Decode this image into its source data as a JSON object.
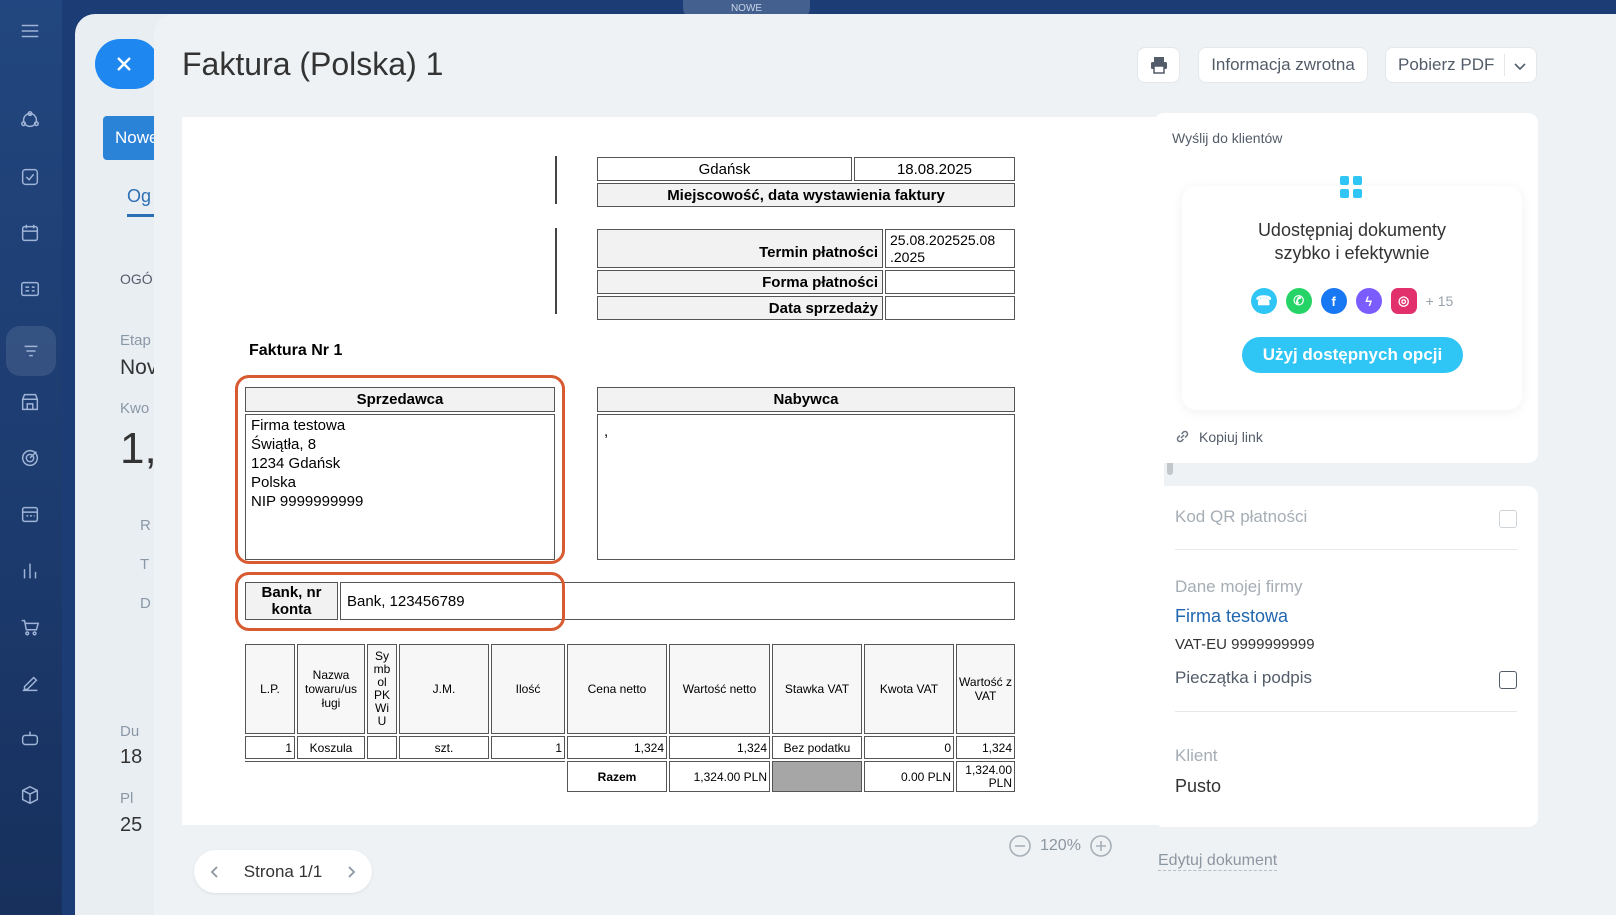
{
  "top_badge": "NOWE",
  "background": {
    "new_button": "Nowe",
    "tab": "Og",
    "section": "OGÓ",
    "stage_label": "Etap",
    "stage_value": "Nov",
    "amount_label": "Kwo",
    "amount_value": "1,",
    "r1": "R",
    "r2": "T",
    "r3": "D",
    "r4": "Du",
    "r5": "18",
    "r6": "Pl",
    "r7": "25"
  },
  "header": {
    "title": "Faktura (Polska) 1",
    "feedback": "Informacja zwrotna",
    "download": "Pobierz PDF"
  },
  "invoice": {
    "place": "Gdańsk",
    "issue_date": "18.08.2025",
    "place_date_label": "Miejscowość, data wystawienia faktury",
    "due_label": "Termin płatności",
    "due_value_1": "25.08.202525.08",
    "due_value_2": ".2025",
    "payment_form_label": "Forma płatności",
    "sale_date_label": "Data sprzedaży",
    "number": "Faktura Nr 1",
    "seller_label": "Sprzedawca",
    "seller_lines": [
      "Firma testowa",
      "Świątła, 8",
      "1234 Gdańsk",
      "Polska",
      "NIP 9999999999"
    ],
    "buyer_label": "Nabywca",
    "buyer_text": ",",
    "bank_label_1": "Bank, nr",
    "bank_label_2": "konta",
    "bank_value": "Bank, 123456789",
    "items_headers": {
      "lp": "L.P.",
      "name_1": "Nazwa",
      "name_2": "towaru/us",
      "name_3": "ługi",
      "sym": [
        "Sy",
        "mb",
        "ol",
        "PK",
        "Wi",
        "U"
      ],
      "unit": "J.M.",
      "qty": "Ilość",
      "price": "Cena netto",
      "net": "Wartość netto",
      "vat_rate": "Stawka VAT",
      "vat_amount": "Kwota VAT",
      "gross_1": "Wartość z",
      "gross_2": "VAT"
    },
    "items": [
      {
        "lp": "1",
        "name": "Koszula",
        "sym": "",
        "unit": "szt.",
        "qty": "1",
        "price": "1,324",
        "net": "1,324",
        "vat_rate": "Bez podatku",
        "vat_amount": "0",
        "gross": "1,324"
      }
    ],
    "total_label": "Razem",
    "total_net": "1,324.00 PLN",
    "total_vat": "0.00 PLN",
    "total_gross_1": "1,324.00",
    "total_gross_2": "PLN"
  },
  "pager": {
    "label": "Strona 1/1"
  },
  "zoom": {
    "value": "120%"
  },
  "send": {
    "title": "Wyślij do klientów",
    "headline_1": "Udostępniaj dokumenty",
    "headline_2": "szybko i efektywnie",
    "more": "+ 15",
    "use_button": "Użyj dostępnych opcji",
    "copy_link": "Kopiuj link"
  },
  "options": {
    "qr_label": "Kod QR płatności",
    "company_label": "Dane mojej firmy",
    "company_name": "Firma testowa",
    "vat": "VAT-EU 9999999999",
    "stamp_label": "Pieczątka i podpis",
    "client_label": "Klient",
    "client_value": "Pusto"
  },
  "edit_link": "Edytuj dokument",
  "colors": {
    "accent": "#2fc6f6",
    "close": "#1e88f0",
    "highlight": "#d85a30",
    "link": "#2067b0"
  }
}
